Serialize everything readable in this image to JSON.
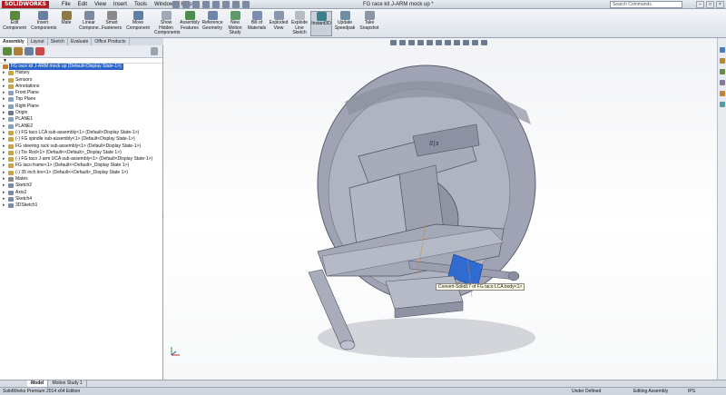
{
  "app": {
    "logo": "SOLIDWORKS",
    "title": "FG race kit J-ARM mock up *",
    "search_placeholder": "Search Commands",
    "menus": [
      "File",
      "Edit",
      "View",
      "Insert",
      "Tools",
      "Window",
      "Help"
    ],
    "window_controls": [
      "–",
      "□",
      "×"
    ]
  },
  "ribbon": {
    "buttons": [
      {
        "label": "Edit\nComponent",
        "icon": "edit-component-icon",
        "color": "#5a8a3c"
      },
      {
        "label": "Insert\nComponents",
        "icon": "insert-components-icon",
        "color": "#6a7fa0"
      },
      {
        "label": "Mate",
        "icon": "mate-icon",
        "color": "#8c7a4a"
      },
      {
        "label": "Linear\nCompone...",
        "icon": "linear-pattern-icon",
        "color": "#7a8aa0"
      },
      {
        "label": "Smart\nFasteners",
        "icon": "fastener-icon",
        "color": "#8a8a8a"
      },
      {
        "label": "Move\nComponent",
        "icon": "move-component-icon",
        "color": "#5e7fa8"
      },
      {
        "label": "Show\nHidden\nComponents",
        "icon": "show-hidden-icon",
        "color": "#a0a8b4"
      },
      {
        "label": "Assembly\nFeatures",
        "icon": "assembly-features-icon",
        "color": "#4f8c4f"
      },
      {
        "label": "Reference\nGeometry",
        "icon": "reference-geometry-icon",
        "color": "#6e86a8"
      },
      {
        "label": "New\nMotion\nStudy",
        "icon": "motion-study-icon",
        "color": "#5f9b6a"
      },
      {
        "label": "Bill of\nMaterials",
        "icon": "bom-icon",
        "color": "#7c8db0"
      },
      {
        "label": "Exploded\nView",
        "icon": "exploded-view-icon",
        "color": "#8a96aa"
      },
      {
        "label": "Explode\nLine\nSketch",
        "icon": "explode-line-icon",
        "color": "#b6bcc6"
      },
      {
        "label": "Instant3D",
        "icon": "instant3d-icon",
        "color": "#3c7f8c"
      },
      {
        "label": "Update\nSpeedpak",
        "icon": "speedpak-icon",
        "color": "#6e8ea8"
      },
      {
        "label": "Take\nSnapshot",
        "icon": "snapshot-icon",
        "color": "#8a96a4"
      }
    ]
  },
  "panel": {
    "tabs": [
      "Assembly",
      "Layout",
      "Sketch",
      "Evaluate",
      "Office Products"
    ],
    "active_tab": "Assembly",
    "tree": [
      {
        "label": "FG race kit J-ARM mock up  (Default<Display State-1>)",
        "root": true,
        "color": "#c87a2a"
      },
      {
        "label": "History",
        "color": "#c8a44a"
      },
      {
        "label": "Sensors",
        "color": "#c8a44a"
      },
      {
        "label": "Annotations",
        "color": "#c8a44a"
      },
      {
        "label": "Front Plane",
        "color": "#8aa0c0"
      },
      {
        "label": "Top Plane",
        "color": "#8aa0c0"
      },
      {
        "label": "Right Plane",
        "color": "#8aa0c0"
      },
      {
        "label": "Origin",
        "color": "#6a7a8a"
      },
      {
        "label": "PLANE1",
        "color": "#8aa0c0"
      },
      {
        "label": "PLANE2",
        "color": "#8aa0c0"
      },
      {
        "label": "(-) FG taco LCA sub-assembly<1> (Default<Display State-1>)",
        "color": "#c8a44a"
      },
      {
        "label": "(-) FG spindle sub-assembly<1> (Default<Display State-1>)",
        "color": "#c8a44a"
      },
      {
        "label": "FG steering rack sub-assembly<1> (Default<Display State-1>)",
        "color": "#c8a44a"
      },
      {
        "label": "(-) Tie Rod<1> (Default<<Default>_Display State 1>)",
        "color": "#c8a44a"
      },
      {
        "label": "(-) FG taco J-arm UCA sub-assembly<1> (Default<Display State-1>)",
        "color": "#c8a44a"
      },
      {
        "label": "FG taco frame<1> (Default<<Default>_Display State 1>)",
        "color": "#c8a44a"
      },
      {
        "label": "(-) 35 inch tire<1> (Default<<Default>_Display State 1>)",
        "color": "#c8a44a"
      },
      {
        "label": "Mates",
        "color": "#8a8a8a"
      },
      {
        "label": "Sketch2",
        "color": "#7a8aa0"
      },
      {
        "label": "Axis2",
        "color": "#7a8aa0"
      },
      {
        "label": "Sketch4",
        "color": "#7a8aa0"
      },
      {
        "label": "3DSketch1",
        "color": "#7a8aa0"
      }
    ]
  },
  "viewport": {
    "tooltip": "Convert-Solid17 of FG taco LCA body<1>"
  },
  "bottom_tabs": [
    "Model",
    "Motion Study 1"
  ],
  "status": {
    "left": "SolidWorks Premium 2014 x64 Edition",
    "under_defined": "Under Defined",
    "editing": "Editing Assembly",
    "units": "IPS"
  },
  "colors": {
    "accent": "#2a64c8",
    "part_fill": "#9fa3b3",
    "highlight": "#2f6bd1",
    "logo_red": "#b01e24"
  }
}
